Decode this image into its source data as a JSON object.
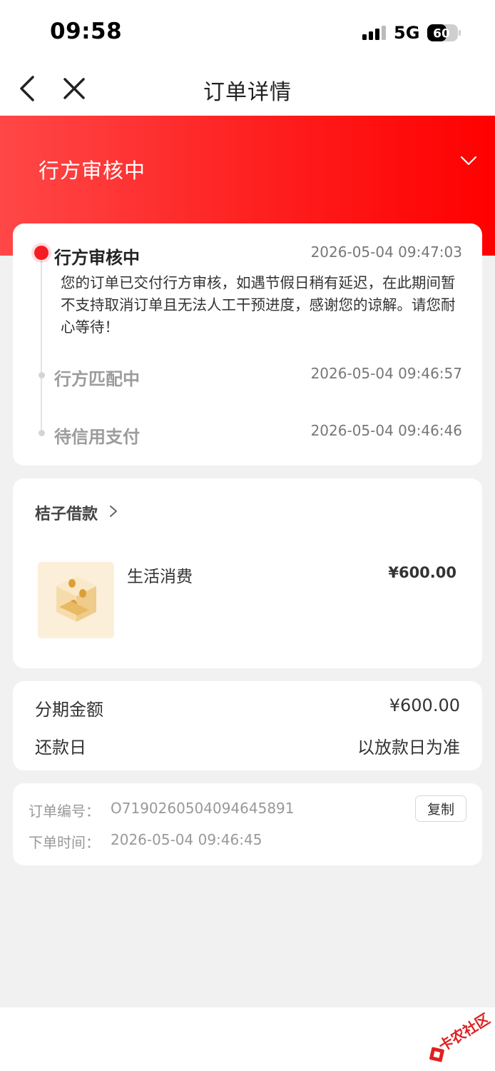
{
  "status_bar": {
    "time": "09:58",
    "network": "5G",
    "battery": "60"
  },
  "nav": {
    "title": "订单详情"
  },
  "banner": {
    "status": "行方审核中"
  },
  "timeline": {
    "items": [
      {
        "title": "行方审核中",
        "time": "2026-05-04 09:47:03",
        "active": true,
        "description": "您的订单已交付行方审核，如遇节假日稍有延迟，在此期间暂不支持取消订单且无法人工干预进度，感谢您的谅解。请您耐心等待！"
      },
      {
        "title": "行方匹配中",
        "time": "2026-05-04 09:46:57",
        "active": false
      },
      {
        "title": "待信用支付",
        "time": "2026-05-04 09:46:46",
        "active": false
      }
    ]
  },
  "merchant": {
    "name": "桔子借款",
    "product_name": "生活消费",
    "price": "¥600.00"
  },
  "summary": {
    "rows": [
      {
        "label": "分期金额",
        "value": "¥600.00"
      },
      {
        "label": "还款日",
        "value": "以放款日为准"
      }
    ]
  },
  "order_info": {
    "number_label": "订单编号：",
    "number": "O7190260504094645891",
    "time_label": "下单时间：",
    "time": "2026-05-04 09:46:45",
    "copy_label": "复制"
  },
  "watermark": {
    "text": "卡农社区"
  },
  "icons": {
    "back": "chevron-left-icon",
    "close": "close-icon",
    "collapse": "chevron-down-icon",
    "merchant_arrow": "chevron-right-icon",
    "signal": "cellular-signal-icon",
    "battery": "battery-icon"
  },
  "colors": {
    "accent_red": "#f51d24",
    "banner_start": "#ff4747",
    "banner_end": "#ff0000",
    "background": "#f1f1f1"
  }
}
